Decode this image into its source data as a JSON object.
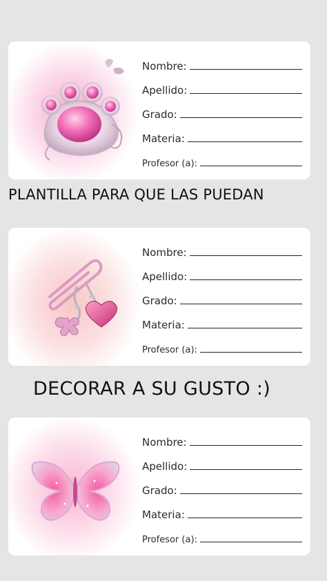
{
  "labels": {
    "nombre": "Nombre:",
    "apellido": "Apellido:",
    "grado": "Grado:",
    "materia": "Materia:",
    "profesor": "Profesor (a):"
  },
  "banner_top": "PLANTILLA PARA QUE LAS PUEDAN",
  "banner_bottom": "DECORAR A SU GUSTO :)",
  "cards": [
    {
      "icon": "paw-charm-icon"
    },
    {
      "icon": "paperclip-heart-charm-icon"
    },
    {
      "icon": "butterfly-icon"
    }
  ],
  "colors": {
    "background": "#e5e5e5",
    "card": "#ffffff",
    "accent_pink": "#f6a9cd"
  }
}
